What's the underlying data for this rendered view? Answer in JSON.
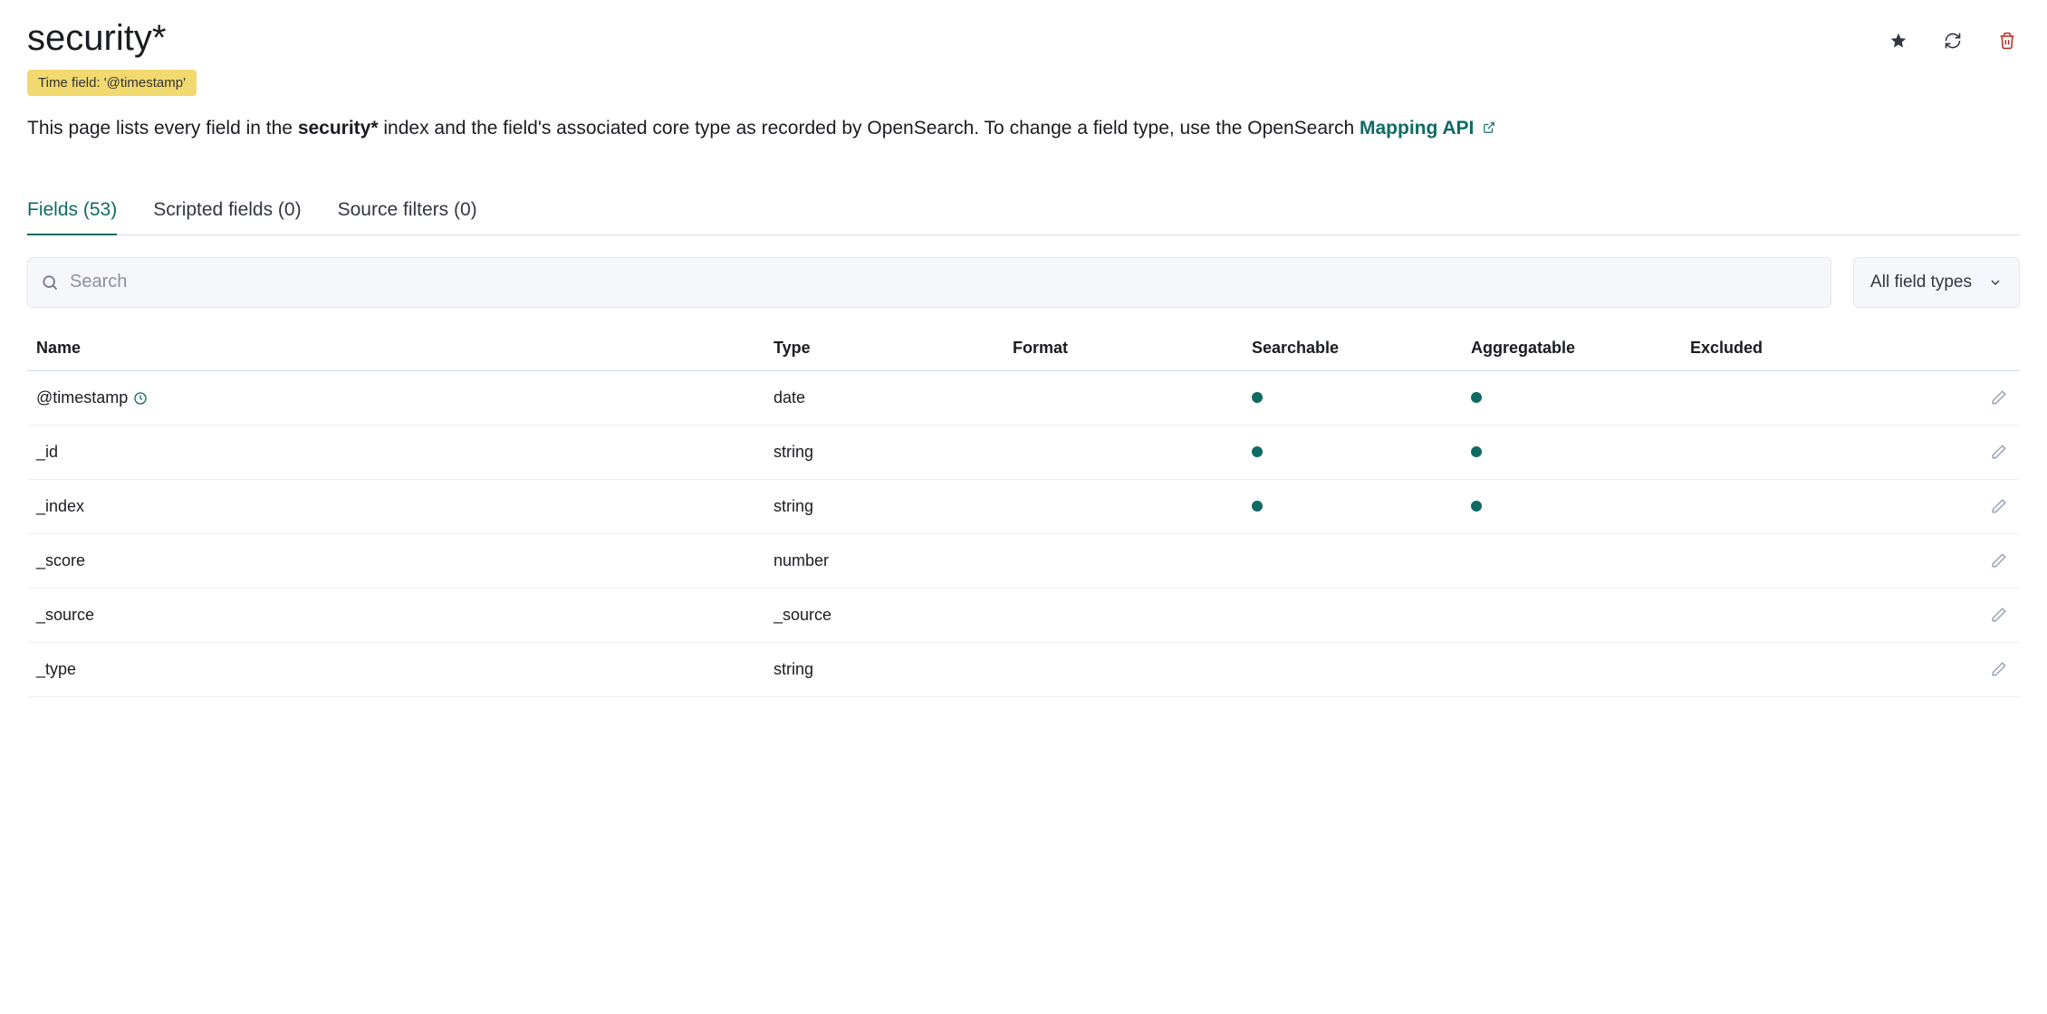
{
  "header": {
    "title": "security*",
    "time_field_badge": "Time field: '@timestamp'"
  },
  "description": {
    "prefix": "This page lists every field in the ",
    "index_name": "security*",
    "middle": " index and the field's associated core type as recorded by OpenSearch. To change a field type, use the OpenSearch ",
    "link_text": "Mapping API"
  },
  "tabs": {
    "fields": "Fields (53)",
    "scripted": "Scripted fields (0)",
    "source_filters": "Source filters (0)"
  },
  "filter": {
    "search_placeholder": "Search",
    "type_select_label": "All field types"
  },
  "columns": {
    "name": "Name",
    "type": "Type",
    "format": "Format",
    "searchable": "Searchable",
    "aggregatable": "Aggregatable",
    "excluded": "Excluded"
  },
  "rows": [
    {
      "name": "@timestamp",
      "type": "date",
      "format": "",
      "searchable": true,
      "aggregatable": true,
      "excluded": false,
      "is_time_field": true
    },
    {
      "name": "_id",
      "type": "string",
      "format": "",
      "searchable": true,
      "aggregatable": true,
      "excluded": false,
      "is_time_field": false
    },
    {
      "name": "_index",
      "type": "string",
      "format": "",
      "searchable": true,
      "aggregatable": true,
      "excluded": false,
      "is_time_field": false
    },
    {
      "name": "_score",
      "type": "number",
      "format": "",
      "searchable": false,
      "aggregatable": false,
      "excluded": false,
      "is_time_field": false
    },
    {
      "name": "_source",
      "type": "_source",
      "format": "",
      "searchable": false,
      "aggregatable": false,
      "excluded": false,
      "is_time_field": false
    },
    {
      "name": "_type",
      "type": "string",
      "format": "",
      "searchable": false,
      "aggregatable": false,
      "excluded": false,
      "is_time_field": false
    }
  ]
}
